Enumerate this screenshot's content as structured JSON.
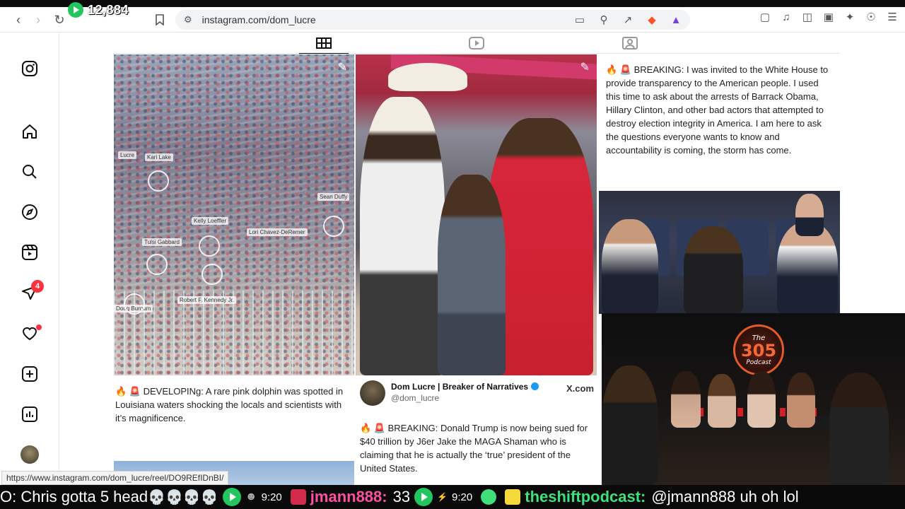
{
  "stream_overlay": {
    "viewer_count": "12,884"
  },
  "browser": {
    "url": "instagram.com/dom_lucre",
    "status_url": "https://www.instagram.com/dom_lucre/reel/DO9REfIDnBI/"
  },
  "sidebar": {
    "notifications_badge": "4"
  },
  "posts": {
    "crowd_tags": [
      "Lucre",
      "Kari Lake",
      "Sean Duffy",
      "Kelly Loeffler",
      "Lori Chavez-DeRemer",
      "Tulsi Gabbard",
      "Robert F. Kennedy Jr.",
      "Doug Burgum"
    ],
    "text_post_1": "🔥 🚨 BREAKING: I was invited to the White House to provide transparency to the American people. I used this time to ask about the arrests of Barrack Obama, Hillary Clinton, and other bad actors that attempted to destroy election integrity in America. I am here to ask the questions everyone wants to know and accountability is coming, the storm has come.",
    "caption_dolphin": "🔥 🚨 DEVELOPINg: A rare pink dolphin was spotted in Louisiana waters shocking the locals and scientists with it’s magnificence.",
    "tweet": {
      "name": "Dom Lucre | Breaker of Narratives",
      "handle": "@dom_lucre",
      "source": "X.com",
      "text": "🔥 🚨 BREAKING: Donald Trump is now being sued for $40 trillion by J6er Jake the MAGA Shaman who is claiming that he is actually the ‘true’ president of the United States."
    }
  },
  "webcam": {
    "logo_top": "The",
    "logo_number": "305",
    "logo_bottom": "Podcast"
  },
  "ticker": {
    "msg1_tail": "O: Chris gotta 5 head",
    "skulls": "💀💀💀💀",
    "time1": "9:20",
    "user2": "jmann888:",
    "msg2": "33",
    "time2": "9:20",
    "user3": "theshiftpodcast:",
    "msg3": "@jmann888 uh oh lol"
  },
  "colors": {
    "accent_badge": "#ff3040",
    "ticker_pink": "#ff4fa0",
    "ticker_green": "#3fe07a"
  }
}
